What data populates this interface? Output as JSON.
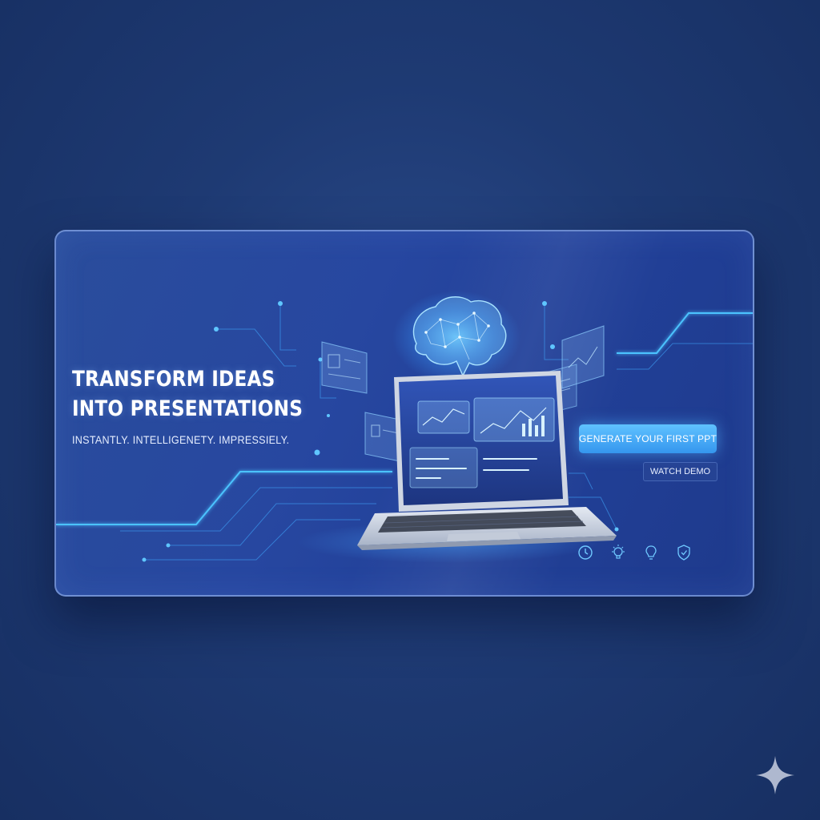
{
  "hero": {
    "headline_line1": "TRANSFORM IDEAS",
    "headline_line2": "INTO PRESENTATIONS",
    "tagline": "INSTANTLY. INTELLIGENETY. IMPRESSIELY."
  },
  "cta": {
    "primary_label": "GENERATE YOUR FIRST PPT",
    "secondary_label": "WATCH DEMO"
  },
  "feature_icons": [
    "clock-icon",
    "lightbulb-spark-icon",
    "lightbulb-icon",
    "shield-icon"
  ],
  "illustration": {
    "brain": "brain-network-icon",
    "device": "laptop"
  },
  "colors": {
    "background": "#1e3a73",
    "card": "#2747a0",
    "accent": "#3fa9ff",
    "primary_button": "#4aaaf5",
    "text": "#ffffff"
  }
}
